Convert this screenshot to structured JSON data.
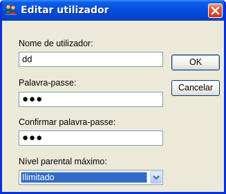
{
  "window": {
    "title": "Editar utilizador",
    "icon": "users-icon",
    "close_icon": "close-icon"
  },
  "form": {
    "username_label": "Nome de utilizador:",
    "username_value": "dd",
    "password_label": "Palavra-passe:",
    "password_value": "●●●",
    "confirm_label": "Confirmar palavra-passe:",
    "confirm_value": "●●●",
    "parental_label": "Nível parental máximo:",
    "parental_value": "Ilimitado"
  },
  "buttons": {
    "ok_label": "OK",
    "cancel_label": "Cancelar"
  },
  "colors": {
    "titlebar": "#0553e0",
    "selection": "#316ac5",
    "dialog_bg": "#ece9d8"
  }
}
